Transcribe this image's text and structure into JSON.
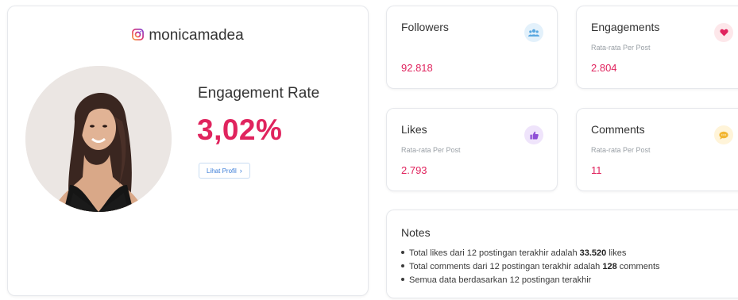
{
  "profile": {
    "handle": "monicamadea",
    "engagement_rate_label": "Engagement Rate",
    "engagement_rate_value": "3,02%",
    "view_profile_label": "Lihat Profil"
  },
  "stats": {
    "followers": {
      "title": "Followers",
      "subtitle": "",
      "value": "92.818",
      "icon": "users-icon"
    },
    "engagements": {
      "title": "Engagements",
      "subtitle": "Rata-rata Per Post",
      "value": "2.804",
      "icon": "heart-icon"
    },
    "likes": {
      "title": "Likes",
      "subtitle": "Rata-rata Per Post",
      "value": "2.793",
      "icon": "thumbs-up-icon"
    },
    "comments": {
      "title": "Comments",
      "subtitle": "Rata-rata Per Post",
      "value": "11",
      "icon": "comment-icon"
    }
  },
  "notes": {
    "title": "Notes",
    "line1_prefix": "Total likes dari 12 postingan terakhir adalah ",
    "line1_bold": "33.520",
    "line1_suffix": " likes",
    "line2_prefix": "Total comments dari 12 postingan terakhir adalah ",
    "line2_bold": "128",
    "line2_suffix": " comments",
    "line3": "Semua data berdasarkan 12 postingan terakhir"
  },
  "colors": {
    "accent": "#e0245e",
    "link": "#3b7dd8",
    "followers_icon": "#5aa8e0",
    "engagements_icon": "#e0245e",
    "likes_icon": "#8e4fd6",
    "comments_icon": "#f2b632"
  }
}
